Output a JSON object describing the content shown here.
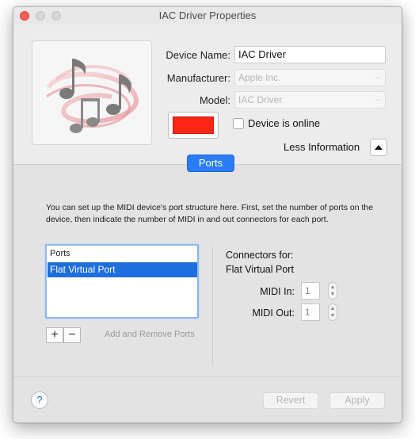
{
  "window": {
    "title": "IAC Driver Properties"
  },
  "device": {
    "name_label": "Device Name:",
    "name_value": "IAC Driver",
    "manufacturer_label": "Manufacturer:",
    "manufacturer_value": "Apple Inc.",
    "model_label": "Model:",
    "model_value": "IAC Driver",
    "icon": "midi-music-notes-icon",
    "color_swatch": "#fd2614",
    "online_checkbox_label": "Device is online",
    "online_checked": false,
    "less_info_label": "Less Information"
  },
  "tabs": {
    "ports_label": "Ports"
  },
  "ports": {
    "description": "You can set up the MIDI device's port structure here.  First, set the number of ports on the device, then indicate the number of MIDI in and out connectors for each port.",
    "list_header": "Ports",
    "items": [
      "Flat Virtual Port"
    ],
    "selected_index": 0,
    "add_remove_label": "Add and Remove Ports",
    "add_symbol": "+",
    "remove_symbol": "−"
  },
  "connectors": {
    "title": "Connectors for:",
    "port_name": "Flat Virtual Port",
    "midi_in_label": "MIDI In:",
    "midi_in_value": "1",
    "midi_out_label": "MIDI Out:",
    "midi_out_value": "1"
  },
  "footer": {
    "help_symbol": "?",
    "revert_label": "Revert",
    "apply_label": "Apply"
  }
}
